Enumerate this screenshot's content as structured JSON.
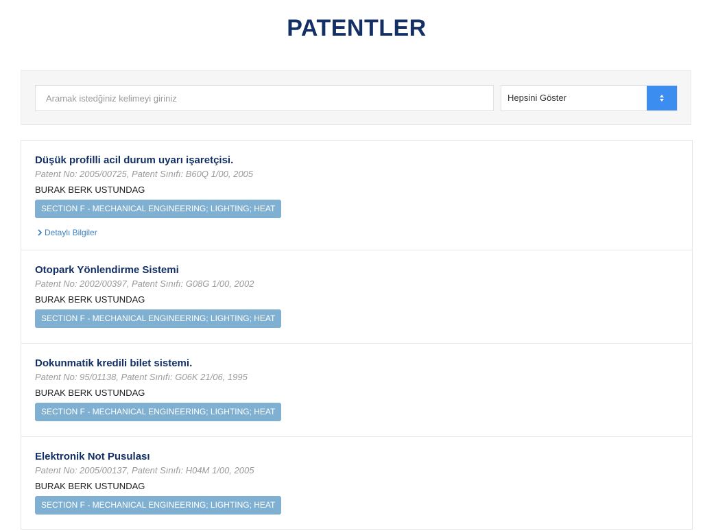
{
  "page": {
    "title": "PATENTLER"
  },
  "search": {
    "placeholder": "Aramak istedğiniz kelimeyi giriniz",
    "value": ""
  },
  "filter": {
    "selected": "Hepsini Göster"
  },
  "patents": [
    {
      "title": "Düşük profilli acil durum uyarı işaretçisi.",
      "meta": "Patent No: 2005/00725, Patent Sınıfı: B60Q 1/00, 2005",
      "owner": "BURAK BERK USTUNDAG",
      "section": "SECTION F - MECHANICAL ENGINEERING; LIGHTING; HEAT",
      "detail_link": "Detaylı Bilgiler"
    },
    {
      "title": "Otopark Yönlendirme Sistemi",
      "meta": "Patent No: 2002/00397, Patent Sınıfı: G08G 1/00, 2002",
      "owner": "BURAK BERK USTUNDAG",
      "section": "SECTION F - MECHANICAL ENGINEERING; LIGHTING; HEAT"
    },
    {
      "title": "Dokunmatik kredili bilet sistemi.",
      "meta": "Patent No: 95/01138, Patent Sınıfı: G06K 21/06, 1995",
      "owner": "BURAK BERK USTUNDAG",
      "section": "SECTION F - MECHANICAL ENGINEERING; LIGHTING; HEAT"
    },
    {
      "title": "Elektronik Not Pusulası",
      "meta": "Patent No: 2005/00137, Patent Sınıfı: H04M 1/00, 2005",
      "owner": "BURAK BERK USTUNDAG",
      "section": "SECTION F - MECHANICAL ENGINEERING; LIGHTING; HEAT"
    }
  ],
  "colors": {
    "title": "#132f63",
    "accent": "#3b8df0",
    "badge": "#7fb0d1",
    "link": "#3b82c4"
  },
  "icons": {
    "select_arrow": "sort-arrows-icon",
    "detail_link": "chevron-right-icon"
  }
}
